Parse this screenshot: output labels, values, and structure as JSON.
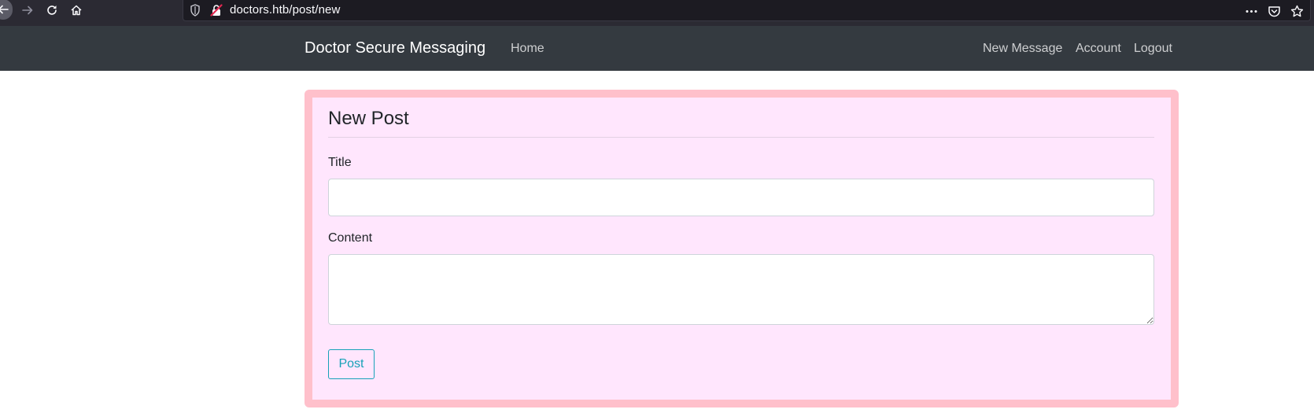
{
  "browser": {
    "url": "doctors.htb/post/new",
    "nav_buttons": [
      "back-arrow-icon",
      "forward-arrow-icon",
      "reload-icon",
      "home-icon"
    ],
    "url_icons": [
      "shield-icon",
      "insecure-lock-icon"
    ],
    "action_icons": [
      "more-dots-icon",
      "pocket-icon",
      "bookmark-star-icon"
    ]
  },
  "site_nav": {
    "brand": "Doctor Secure Messaging",
    "home": "Home",
    "new_message": "New Message",
    "account": "Account",
    "logout": "Logout"
  },
  "form": {
    "legend": "New Post",
    "title_label": "Title",
    "title_value": "",
    "content_label": "Content",
    "content_value": "",
    "submit_label": "Post"
  },
  "colors": {
    "navbar_bg": "#343a40",
    "card_bg": "#ffe6fd",
    "card_border": "#ffc0cb",
    "button_accent": "#17a2b8"
  }
}
